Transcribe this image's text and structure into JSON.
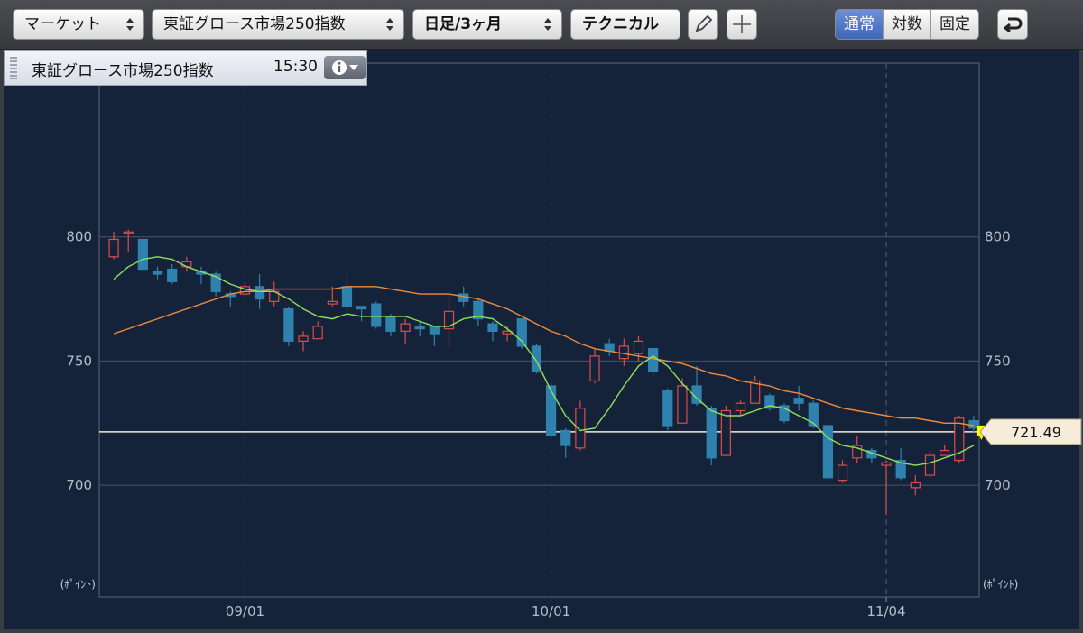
{
  "toolbar": {
    "market_label": "マーケット",
    "index_label": "東証グロース市場250指数",
    "period_label": "日足/3ヶ月",
    "technical_label": "テクニカル",
    "modes": [
      "通常",
      "対数",
      "固定"
    ],
    "active_mode": "通常"
  },
  "panel": {
    "title": "東証グロース市場250指数",
    "time": "15:30"
  },
  "colors": {
    "up": "#e04a4a",
    "down": "#2f82ad",
    "ma_short": "#8fe05a",
    "ma_long": "#f08a3a",
    "current_line": "#f5ecd9",
    "current_marker": "#ffff00"
  },
  "chart_data": {
    "type": "candlestick",
    "y_ticks": [
      700,
      750,
      800
    ],
    "ylim": [
      655,
      870
    ],
    "ylabel_left": "(ﾎﾟｲﾝﾄ)",
    "ylabel_right": "(ﾎﾟｲﾝﾄ)",
    "x_ticks": [
      {
        "label": "09/01",
        "index": 9
      },
      {
        "label": "10/01",
        "index": 30
      },
      {
        "label": "11/04",
        "index": 53
      }
    ],
    "current_value": 721.49,
    "current_label": "721.49",
    "candles": [
      [
        792,
        799,
        791,
        802
      ],
      [
        802,
        802,
        794,
        803
      ],
      [
        799,
        787,
        786,
        799
      ],
      [
        786,
        785,
        783,
        788
      ],
      [
        787,
        782,
        781,
        789
      ],
      [
        788,
        790,
        786,
        792
      ],
      [
        786,
        785,
        781,
        788
      ],
      [
        785,
        778,
        776,
        786
      ],
      [
        777,
        776,
        772,
        778
      ],
      [
        777,
        780,
        775,
        782
      ],
      [
        780,
        775,
        771,
        785
      ],
      [
        774,
        778,
        772,
        782
      ],
      [
        771,
        758,
        756,
        772
      ],
      [
        758,
        760,
        754,
        762
      ],
      [
        759,
        764,
        759,
        766
      ],
      [
        773,
        774,
        772,
        780
      ],
      [
        780,
        772,
        770,
        785
      ],
      [
        772,
        771,
        766,
        772
      ],
      [
        773,
        764,
        763,
        774
      ],
      [
        768,
        762,
        760,
        769
      ],
      [
        762,
        765,
        757,
        767
      ],
      [
        764,
        763,
        760,
        766
      ],
      [
        764,
        761,
        756,
        764
      ],
      [
        763,
        770,
        755,
        776
      ],
      [
        777,
        774,
        772,
        780
      ],
      [
        774,
        767,
        764,
        775
      ],
      [
        765,
        762,
        758,
        766
      ],
      [
        761,
        762,
        758,
        764
      ],
      [
        767,
        756,
        755,
        767
      ],
      [
        756,
        746,
        745,
        757
      ],
      [
        740,
        720,
        719,
        741
      ],
      [
        722,
        716,
        711,
        723
      ],
      [
        715,
        731,
        714,
        734
      ],
      [
        742,
        752,
        741,
        755
      ],
      [
        757,
        754,
        752,
        759
      ],
      [
        751,
        756,
        748,
        759
      ],
      [
        753,
        758,
        750,
        760
      ],
      [
        755,
        746,
        744,
        755
      ],
      [
        738,
        724,
        722,
        739
      ],
      [
        725,
        740,
        725,
        743
      ],
      [
        740,
        733,
        732,
        748
      ],
      [
        731,
        711,
        708,
        732
      ],
      [
        712,
        730,
        712,
        732
      ],
      [
        730,
        733,
        728,
        734
      ],
      [
        733,
        742,
        733,
        744
      ],
      [
        736,
        731,
        730,
        737
      ],
      [
        732,
        726,
        725,
        733
      ],
      [
        735,
        733,
        730,
        740
      ],
      [
        733,
        724,
        723,
        734
      ],
      [
        724,
        703,
        702,
        724
      ],
      [
        702,
        708,
        701,
        710
      ],
      [
        711,
        716,
        709,
        720
      ],
      [
        714,
        711,
        709,
        715
      ],
      [
        708,
        709,
        688,
        710
      ],
      [
        710,
        703,
        702,
        715
      ],
      [
        699,
        701,
        696,
        704
      ],
      [
        704,
        712,
        703,
        714
      ],
      [
        712,
        714,
        712,
        716
      ],
      [
        710,
        727,
        709,
        728
      ],
      [
        726,
        723,
        721,
        728
      ]
    ],
    "ma_short": [
      783,
      788,
      791,
      792,
      791,
      788,
      786,
      784,
      781,
      779,
      778,
      778,
      775,
      771,
      768,
      767,
      769,
      768,
      768,
      768,
      768,
      766,
      764,
      764,
      767,
      768,
      767,
      763,
      758,
      750,
      738,
      728,
      722,
      723,
      731,
      740,
      748,
      752,
      748,
      741,
      735,
      730,
      728,
      728,
      730,
      732,
      731,
      728,
      725,
      719,
      716,
      715,
      713,
      711,
      709,
      708,
      709,
      711,
      713,
      716
    ],
    "ma_long": [
      761,
      763,
      765,
      767,
      769,
      771,
      773,
      775,
      777,
      778,
      778,
      779,
      779,
      779,
      779,
      779,
      780,
      780,
      780,
      779,
      778,
      777,
      777,
      777,
      776,
      775,
      773,
      771,
      768,
      765,
      762,
      760,
      757,
      755,
      754,
      753,
      752,
      751,
      750,
      749,
      747,
      745,
      744,
      742,
      741,
      740,
      738,
      737,
      735,
      733,
      731,
      730,
      729,
      728,
      727,
      727,
      726,
      725,
      725,
      724
    ]
  }
}
